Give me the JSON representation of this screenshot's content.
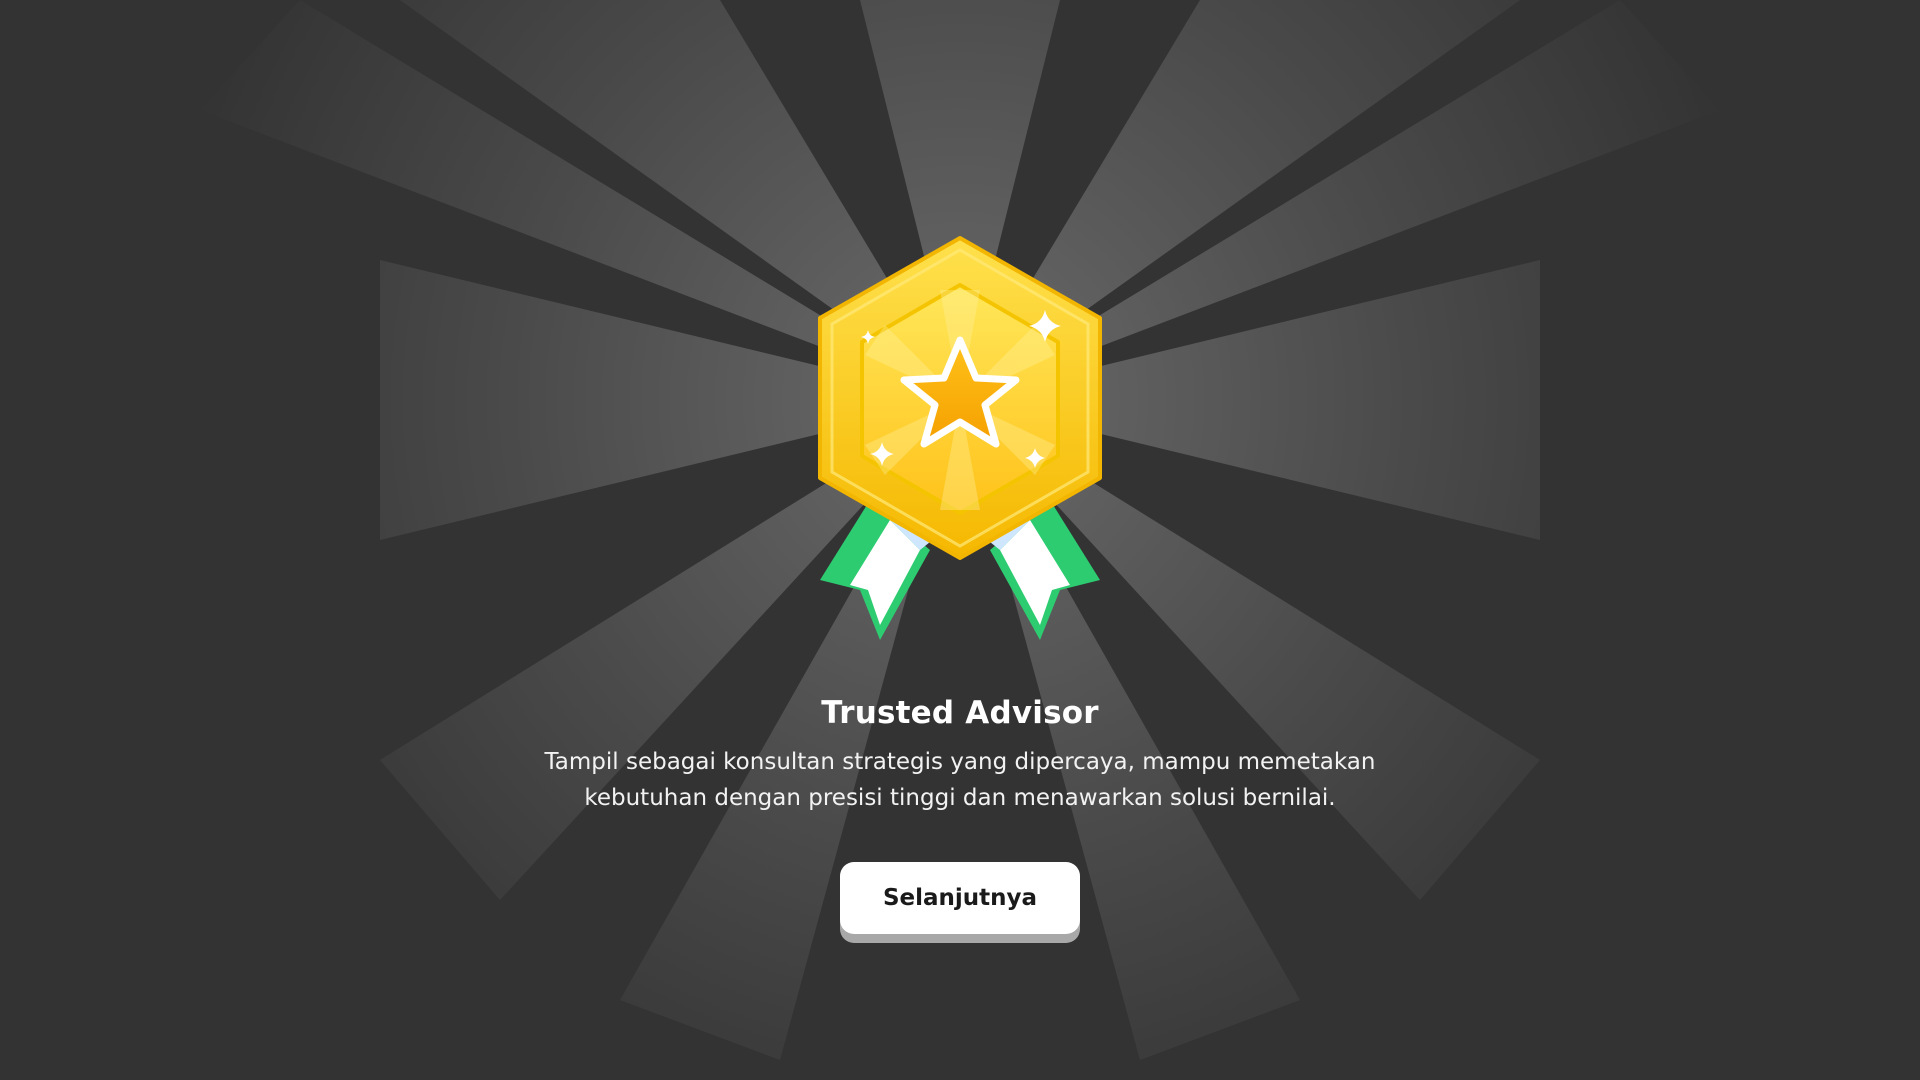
{
  "badge": {
    "title": "Trusted Advisor",
    "description": "Tampil sebagai konsultan strategis yang dipercaya, mampu memetakan kebutuhan dengan presisi tinggi dan menawarkan solusi bernilai.",
    "icon": "star-medal-icon"
  },
  "actions": {
    "next_label": "Selanjutnya"
  },
  "colors": {
    "background": "#333333",
    "medal_gold": "#FFC928",
    "medal_inner": "#FFD93B",
    "ribbon_green": "#2ECC71",
    "button_bg": "#FFFFFF"
  }
}
